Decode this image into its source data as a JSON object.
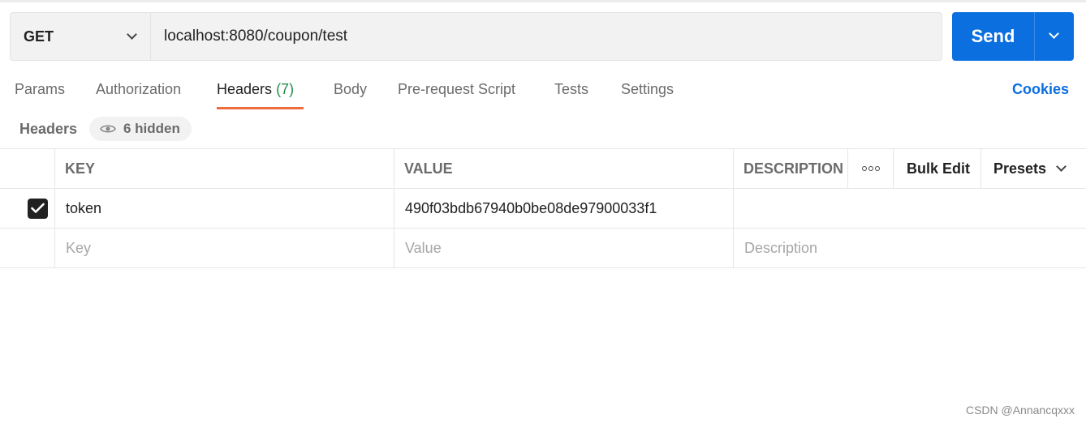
{
  "request": {
    "method": "GET",
    "url": "localhost:8080/coupon/test",
    "send_label": "Send"
  },
  "tabs": {
    "params": "Params",
    "authorization": "Authorization",
    "headers": "Headers",
    "headers_count": "(7)",
    "body": "Body",
    "prerequest": "Pre-request Script",
    "tests": "Tests",
    "settings": "Settings",
    "cookies": "Cookies"
  },
  "headers_section": {
    "title": "Headers",
    "hidden_label": "6 hidden"
  },
  "table": {
    "columns": {
      "key": "KEY",
      "value": "VALUE",
      "description": "DESCRIPTION"
    },
    "actions": {
      "bulk_edit": "Bulk Edit",
      "presets": "Presets"
    },
    "rows": [
      {
        "checked": true,
        "key": "token",
        "value": "490f03bdb67940b0be08de97900033f1",
        "description": ""
      }
    ],
    "placeholders": {
      "key": "Key",
      "value": "Value",
      "description": "Description"
    }
  },
  "watermark": "CSDN @Annancqxxx",
  "colors": {
    "accent": "#0b6fe0",
    "active_tab": "#ef6c3f",
    "count": "#1f8f4a"
  }
}
